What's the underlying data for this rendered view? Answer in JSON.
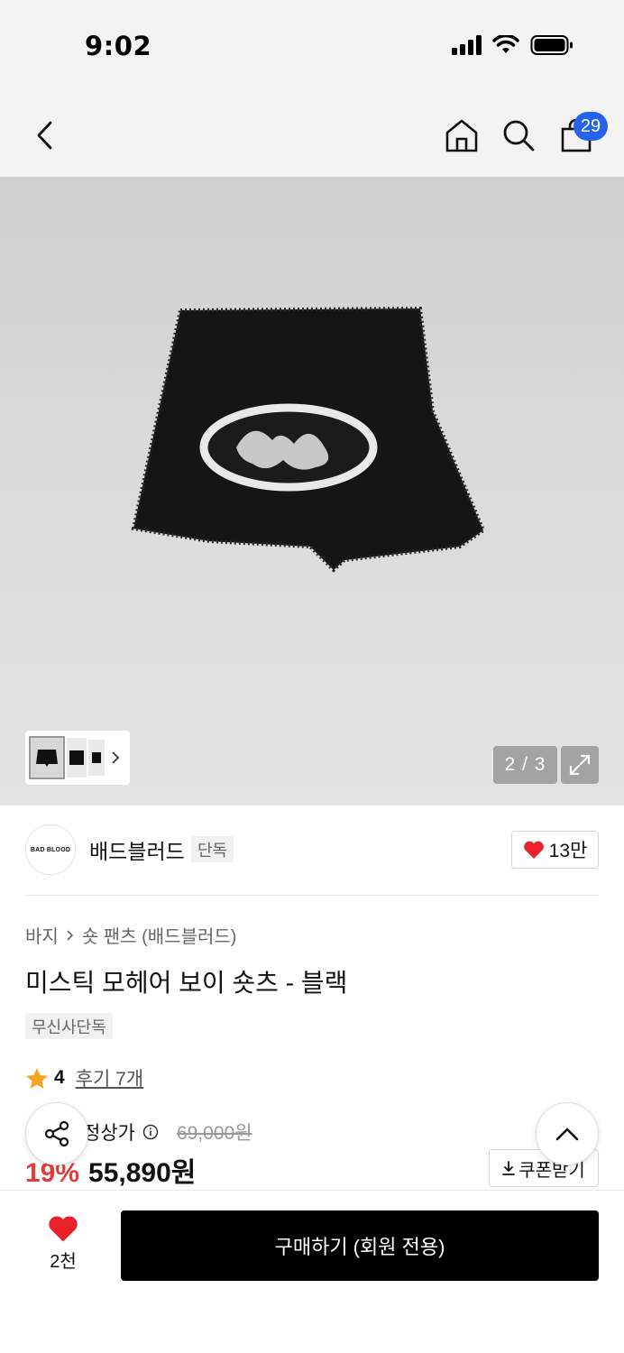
{
  "status_bar": {
    "time": "9:02"
  },
  "header": {
    "cart_count": "29"
  },
  "gallery": {
    "page_indicator": "2 / 3",
    "current_index": 2,
    "total": 3
  },
  "brand": {
    "logo_text": "BAD BLOOD",
    "name": "배드블러드",
    "tag": "단독",
    "like_count": "13만"
  },
  "product": {
    "breadcrumb": [
      "바지",
      "숏 팬츠 (배드블러드)"
    ],
    "title": "미스틱 모헤어 보이 숏츠 - 블랙",
    "exclusive_tag": "무신사단독",
    "rating": "4",
    "review_link": "후기 7개"
  },
  "price": {
    "label": "정상가",
    "original": "69,000원",
    "discount": "19%",
    "final": "55,890원",
    "coupon_label": "쿠폰받기"
  },
  "bottom_bar": {
    "like_count": "2천",
    "buy_label": "구매하기 (회원 전용)"
  },
  "colors": {
    "accent_blue": "#2563eb",
    "heart_red": "#e8202a",
    "discount_red": "#e23b3b",
    "star_orange": "#f5a623"
  },
  "icons": [
    "back-icon",
    "home-icon",
    "search-icon",
    "cart-icon",
    "expand-icon",
    "heart-icon",
    "star-icon",
    "info-icon",
    "share-icon",
    "chevron-up-icon",
    "download-icon"
  ]
}
